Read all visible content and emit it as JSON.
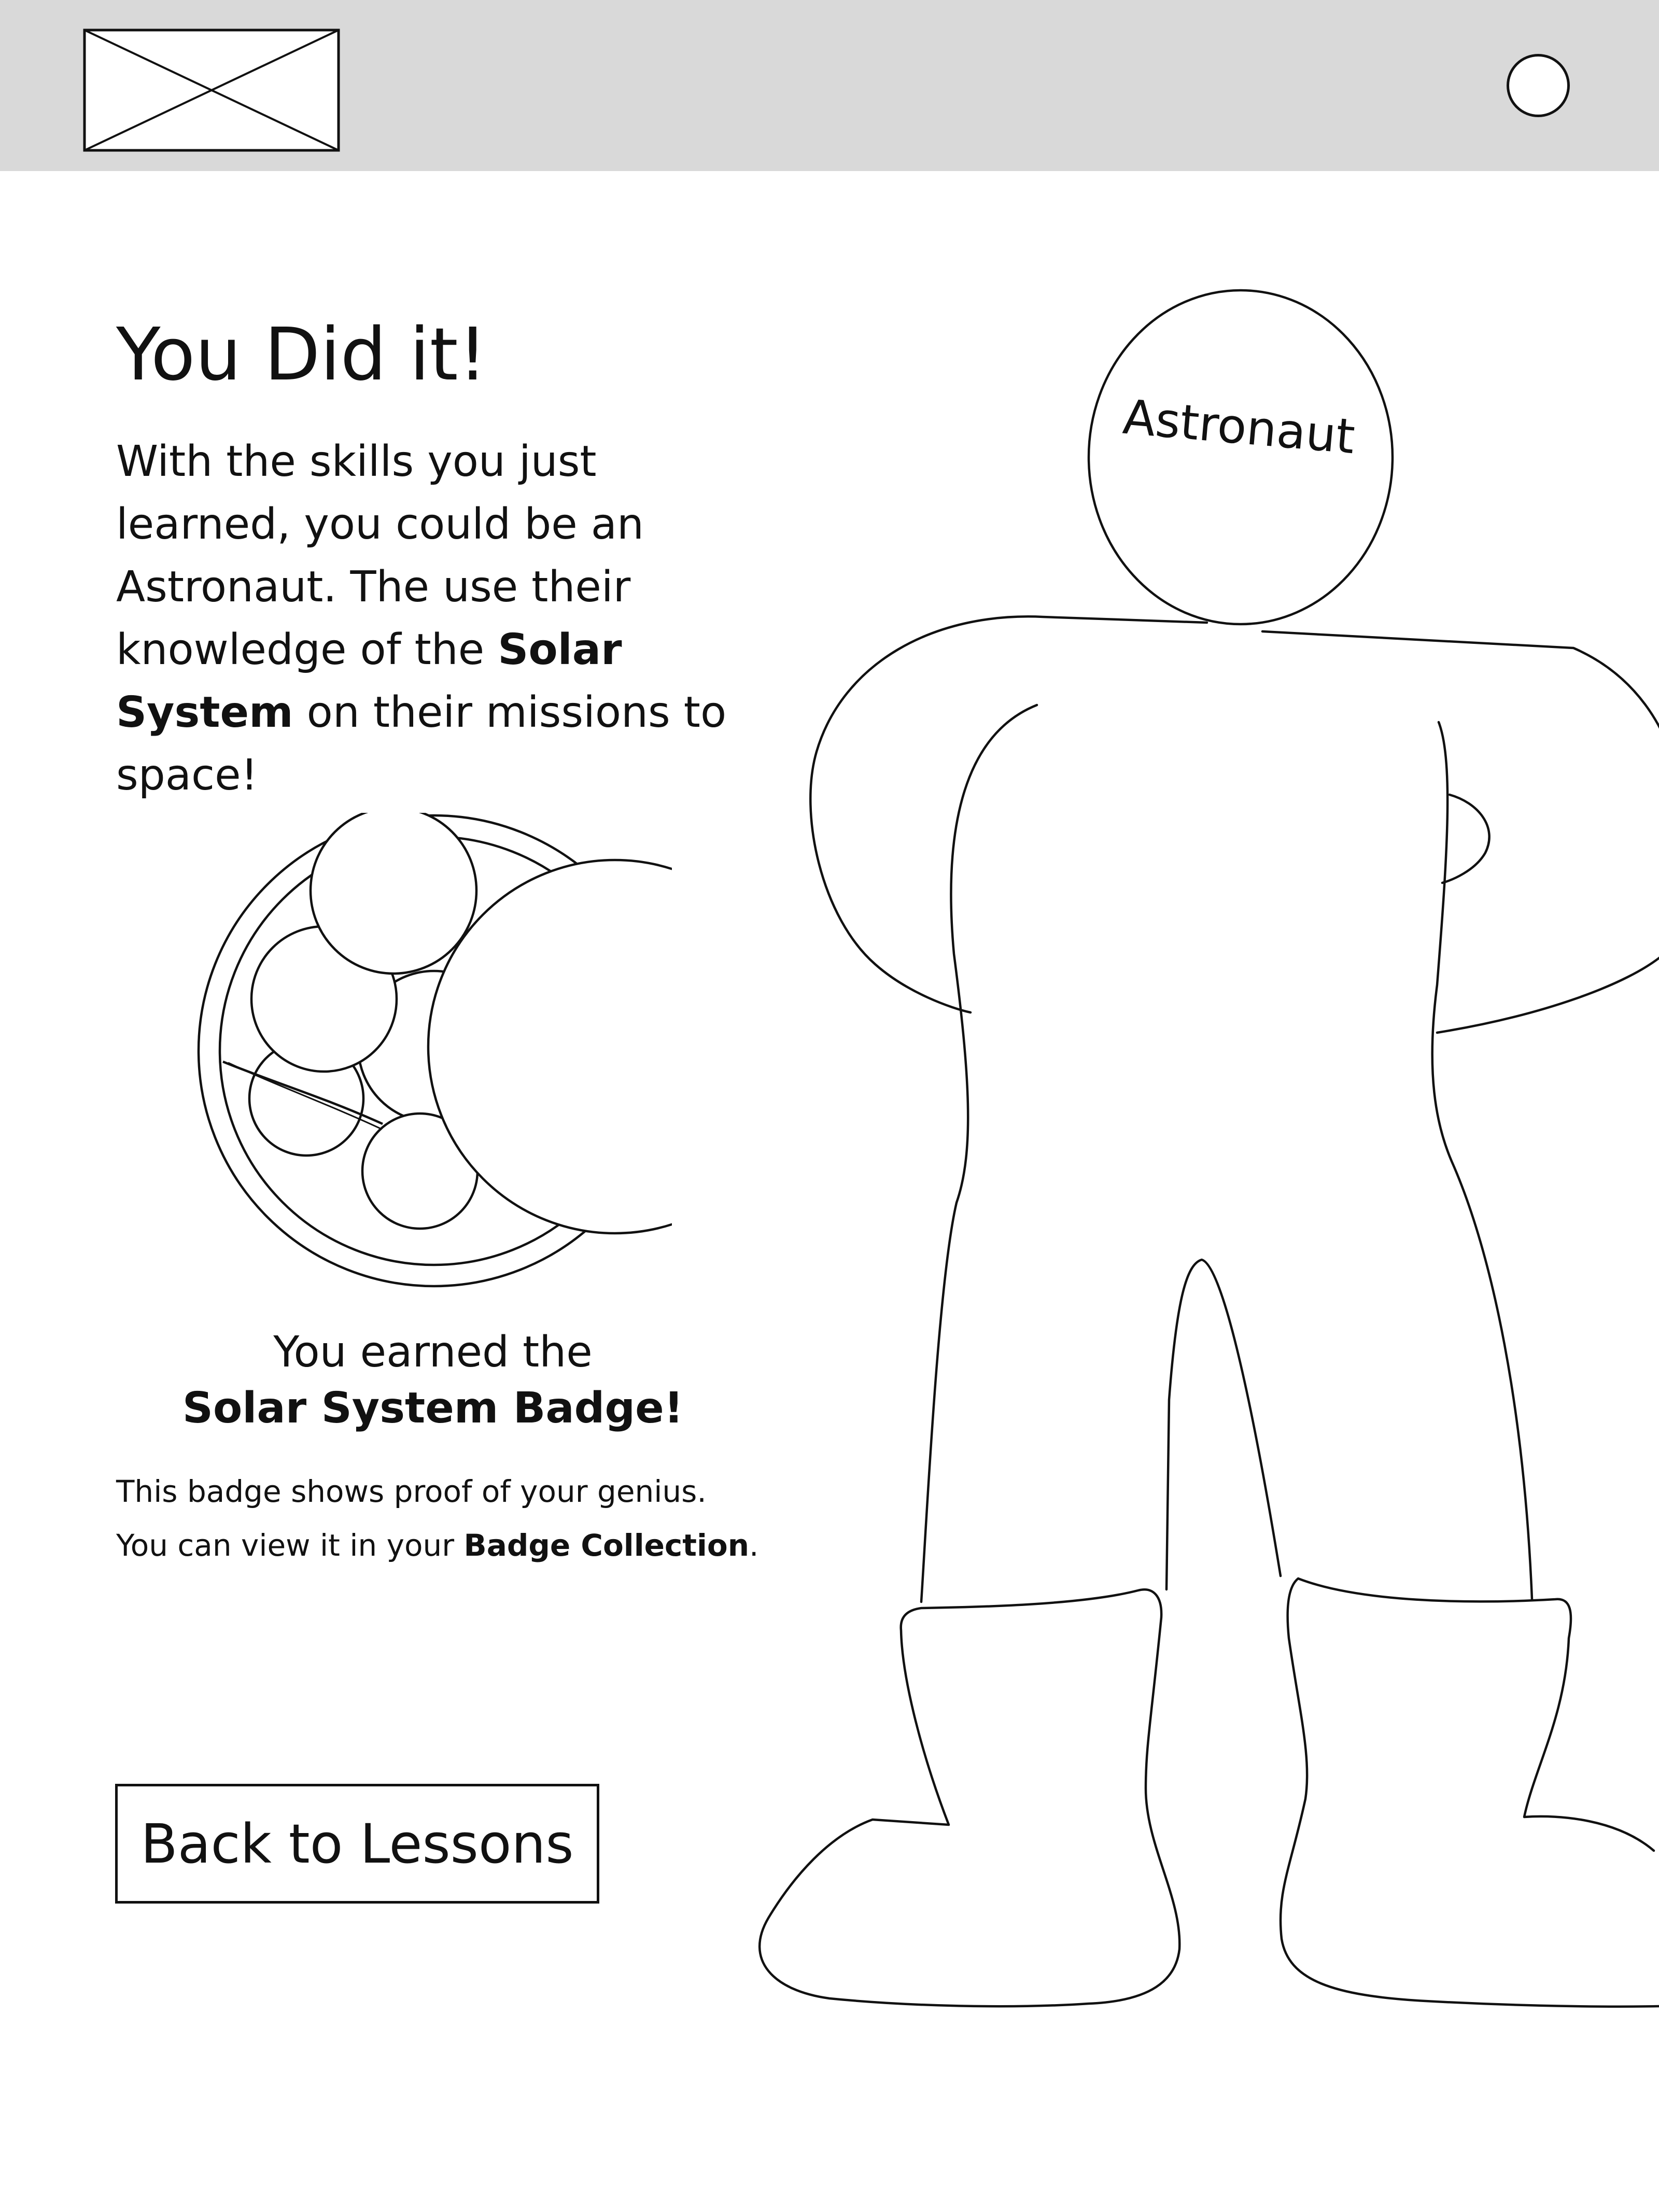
{
  "header": {
    "logo_icon": "image-placeholder-icon",
    "profile_icon": "avatar-circle-icon",
    "background": "#d9d9d9"
  },
  "main": {
    "title": "You Did it!",
    "intro": {
      "text_before": "With the skills you just learned, you could be an Astronaut. The use their knowledge of the ",
      "highlight": "Solar System",
      "text_after": " on their missions to space!"
    },
    "badge": {
      "icon": "solar-system-badge-icon",
      "earned_line1": "You earned the",
      "earned_line2": "Solar System Badge!",
      "proof_line1": "This badge shows proof of your genius.",
      "proof_line2_before": "You can view it in your ",
      "proof_line2_link": "Badge Collection",
      "proof_line2_after": "."
    },
    "back_button_label": "Back to Lessons"
  },
  "illustration": {
    "icon": "astronaut-icon",
    "label": "Astronaut"
  }
}
